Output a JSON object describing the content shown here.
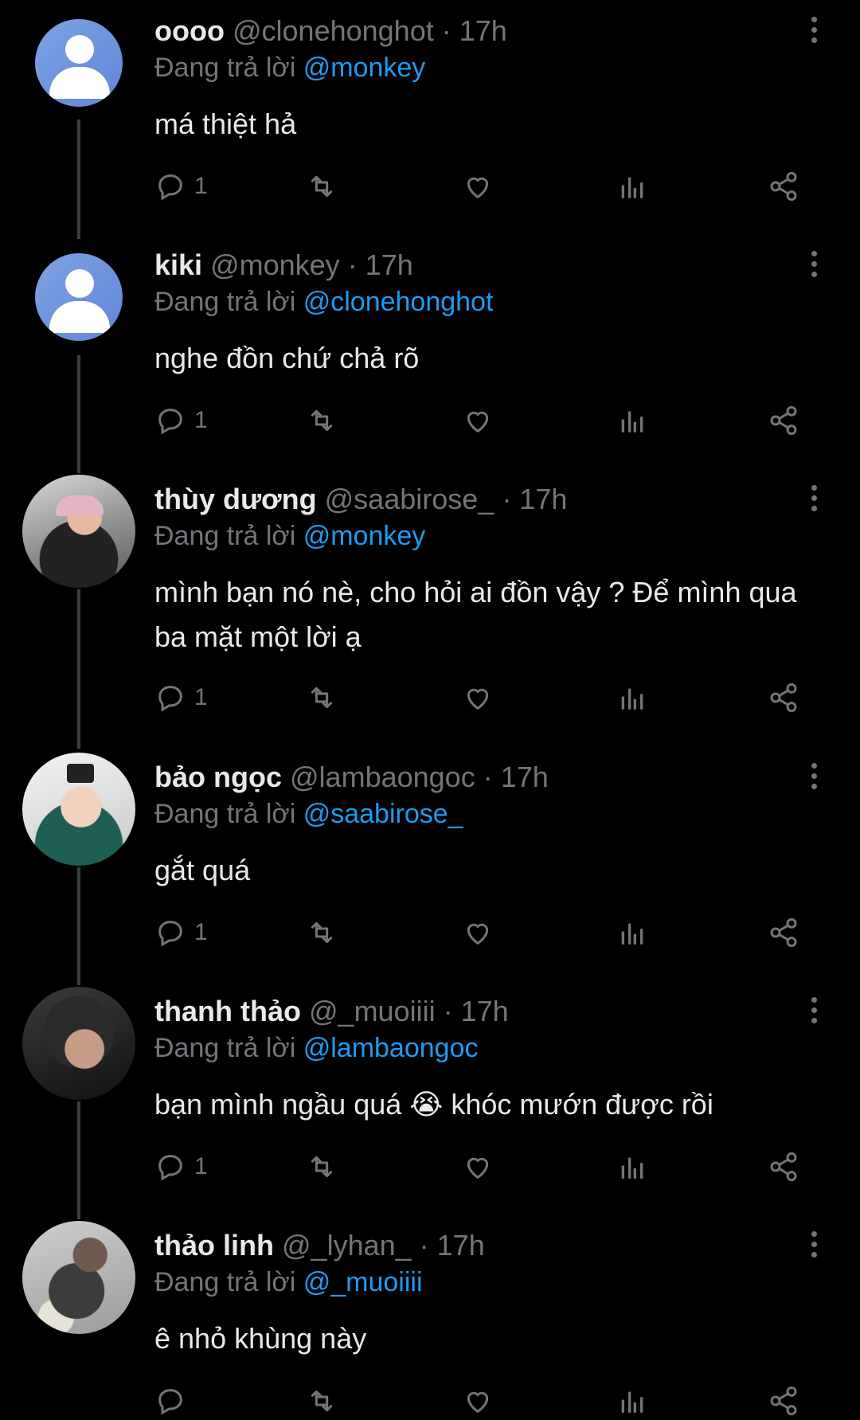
{
  "reply_prefix": "Đang trả lời",
  "posts": [
    {
      "name": "oooo",
      "handle": "@clonehonghot",
      "time": "· 17h",
      "reply_to": "@monkey",
      "text": "má thiệt hả",
      "replies": "1"
    },
    {
      "name": "kiki",
      "handle": "@monkey",
      "time": "· 17h",
      "reply_to": "@clonehonghot",
      "text": "nghe đồn chứ chả rõ",
      "replies": "1"
    },
    {
      "name": "thùy dương",
      "handle": "@saabirose_",
      "time": "· 17h",
      "reply_to": "@monkey",
      "text": "mình bạn nó nè, cho hỏi ai đồn vậy ? Để mình qua ba mặt một lời ạ",
      "replies": "1"
    },
    {
      "name": "bảo ngọc",
      "handle": "@lambaongoc",
      "time": "· 17h",
      "reply_to": "@saabirose_",
      "text": "gắt quá",
      "replies": "1"
    },
    {
      "name": "thanh thảo",
      "handle": "@_muoiiii",
      "time": "· 17h",
      "reply_to": "@lambaongoc",
      "text": "bạn mình ngầu quá 😭 khóc mướn được rồi",
      "replies": "1"
    },
    {
      "name": "thảo linh",
      "handle": "@_lyhan_",
      "time": "· 17h",
      "reply_to": "@_muoiiii",
      "text": "ê nhỏ khùng này",
      "replies": ""
    }
  ],
  "colors": {
    "background": "#000000",
    "text": "#e7e9ea",
    "muted": "#71767b",
    "mention": "#1d9bf0"
  }
}
